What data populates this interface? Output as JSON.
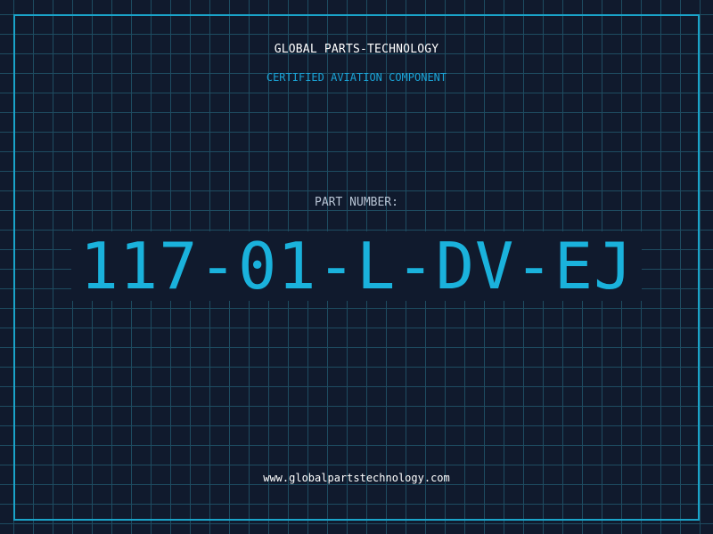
{
  "header": {
    "company": "GLOBAL PARTS-TECHNOLOGY",
    "subtitle": "CERTIFIED AVIATION COMPONENT"
  },
  "part": {
    "label": "PART NUMBER:",
    "number": "117-01-L-DV-EJ"
  },
  "footer": {
    "website": "www.globalpartstechnology.com"
  },
  "colors": {
    "background": "#101a2d",
    "grid": "#1e4c61",
    "accent": "#1ab2dc",
    "text": "#ffffff"
  }
}
